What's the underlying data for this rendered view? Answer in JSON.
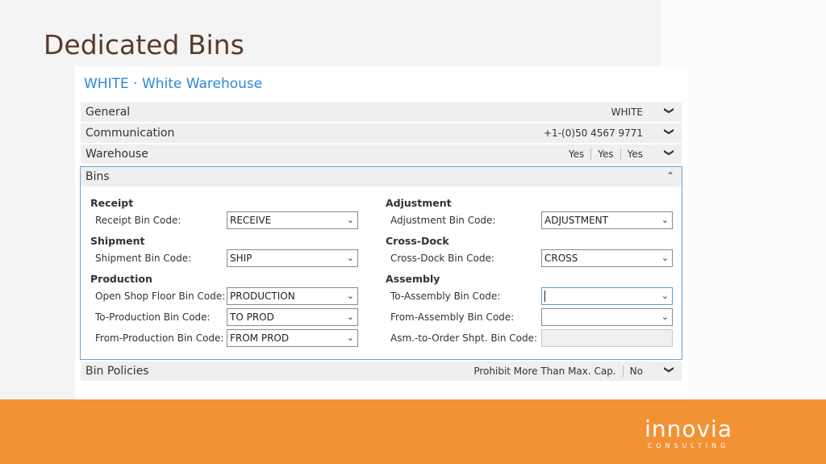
{
  "slide": {
    "title": "Dedicated Bins"
  },
  "panel": {
    "title": "WHITE · White Warehouse"
  },
  "fasttabs": {
    "general": {
      "label": "General",
      "summary": "WHITE"
    },
    "communication": {
      "label": "Communication",
      "summary": "+1-(0)50 4567 9771"
    },
    "warehouse": {
      "label": "Warehouse",
      "summary": [
        "Yes",
        "Yes",
        "Yes"
      ]
    },
    "bins": {
      "label": "Bins"
    },
    "bin_policies": {
      "label": "Bin Policies",
      "summary_label": "Prohibit More Than Max. Cap.",
      "summary_value": "No"
    }
  },
  "bins": {
    "receipt": {
      "heading": "Receipt",
      "label": "Receipt Bin Code:",
      "value": "RECEIVE"
    },
    "shipment": {
      "heading": "Shipment",
      "label": "Shipment Bin Code:",
      "value": "SHIP"
    },
    "production": {
      "heading": "Production",
      "open_shop_label": "Open Shop Floor Bin Code:",
      "open_shop_value": "PRODUCTION",
      "to_prod_label": "To-Production Bin Code:",
      "to_prod_value": "TO PROD",
      "from_prod_label": "From-Production Bin Code:",
      "from_prod_value": "FROM PROD"
    },
    "adjustment": {
      "heading": "Adjustment",
      "label": "Adjustment Bin Code:",
      "value": "ADJUSTMENT"
    },
    "cross_dock": {
      "heading": "Cross-Dock",
      "label": "Cross-Dock Bin Code:",
      "value": "CROSS"
    },
    "assembly": {
      "heading": "Assembly",
      "to_label": "To-Assembly Bin Code:",
      "to_value": "",
      "from_label": "From-Assembly Bin Code:",
      "from_value": "",
      "ato_label": "Asm.-to-Order Shpt. Bin Code:",
      "ato_value": ""
    }
  },
  "logo": {
    "name": "innovia",
    "sub": "CONSULTING"
  },
  "colors": {
    "accent": "#2b88d8",
    "footer": "#f39234",
    "title": "#5a3a2e"
  }
}
